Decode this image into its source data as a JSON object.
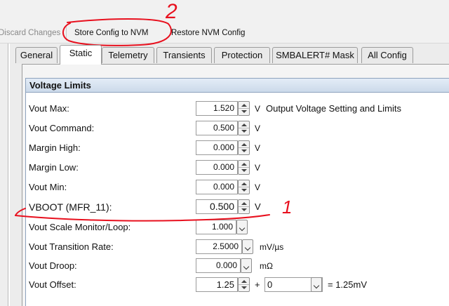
{
  "toolbar": {
    "discard": "Discard Changes",
    "store": "Store Config to NVM",
    "restore": "Restore NVM Config"
  },
  "tabs": [
    "General",
    "Static",
    "Telemetry",
    "Transients",
    "Protection",
    "SMBALERT# Mask",
    "All Config"
  ],
  "active_tab": "Static",
  "section": {
    "title": "Voltage Limits"
  },
  "rows": {
    "vout_max": {
      "label": "Vout Max:",
      "value": "1.520",
      "unit": "V",
      "desc": "Output Voltage Setting and Limits"
    },
    "vout_command": {
      "label": "Vout Command:",
      "value": "0.500",
      "unit": "V"
    },
    "margin_high": {
      "label": "Margin High:",
      "value": "0.000",
      "unit": "V"
    },
    "margin_low": {
      "label": "Margin Low:",
      "value": "0.000",
      "unit": "V"
    },
    "vout_min": {
      "label": "Vout Min:",
      "value": "0.000",
      "unit": "V"
    },
    "vboot": {
      "label": "VBOOT (MFR_11):",
      "value": "0.500",
      "unit": "V"
    },
    "vout_scale": {
      "label": "Vout Scale Monitor/Loop:",
      "value": "1.000"
    },
    "vout_transition": {
      "label": "Vout Transition Rate:",
      "value": "2.5000",
      "unit": "mV/µs"
    },
    "vout_droop": {
      "label": "Vout Droop:",
      "value": "0.000",
      "unit": "mΩ"
    },
    "vout_offset": {
      "label": "Vout Offset:",
      "value": "1.25",
      "plus": "+",
      "offset_select": "0",
      "result": "= 1.25mV"
    }
  },
  "annotations": {
    "mark_1": "1",
    "mark_2": "2",
    "color": "#e8101e"
  }
}
